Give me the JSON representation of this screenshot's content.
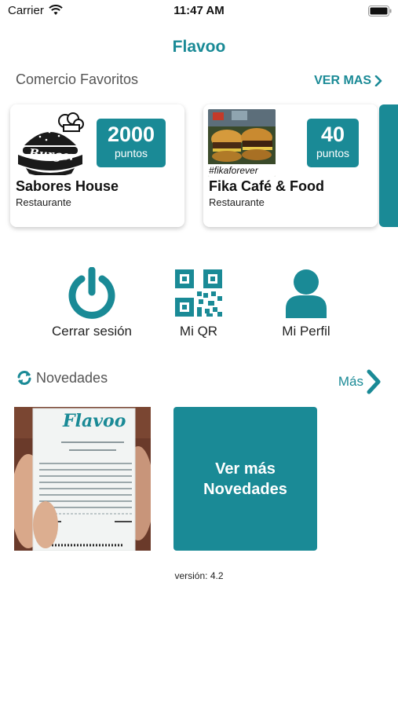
{
  "status_bar": {
    "carrier": "Carrier",
    "time": "11:47 AM"
  },
  "app": {
    "title": "Flavoo"
  },
  "favorites": {
    "title": "Comercio Favoritos",
    "see_more": "VER MAS",
    "cards": [
      {
        "name": "Sabores House",
        "type": "Restaurante",
        "points": "2000",
        "points_label": "puntos",
        "logo_text": "Burger"
      },
      {
        "name": "Fika Café & Food",
        "type": "Restaurante",
        "points": "40",
        "points_label": "puntos",
        "photo_tag": "#fikaforever"
      }
    ]
  },
  "actions": [
    {
      "label": "Cerrar sesión",
      "icon": "power-icon"
    },
    {
      "label": "Mi QR",
      "icon": "qr-code-icon"
    },
    {
      "label": "Mi Perfil",
      "icon": "user-icon"
    }
  ],
  "news": {
    "title": "Novedades",
    "more": "Más",
    "photo": {
      "brand": "Flavoo"
    },
    "tile_label": "Ver más Novedades"
  },
  "footer": {
    "version": "versión: 4.2"
  },
  "colors": {
    "accent": "#1a8a96"
  }
}
